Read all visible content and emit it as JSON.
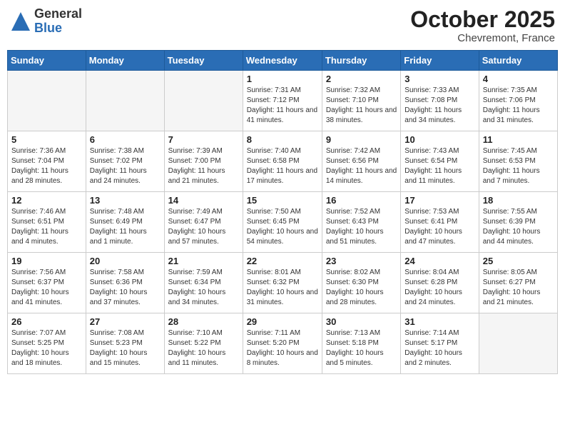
{
  "header": {
    "logo_general": "General",
    "logo_blue": "Blue",
    "month_title": "October 2025",
    "location": "Chevremont, France"
  },
  "weekdays": [
    "Sunday",
    "Monday",
    "Tuesday",
    "Wednesday",
    "Thursday",
    "Friday",
    "Saturday"
  ],
  "weeks": [
    [
      {
        "day": "",
        "info": ""
      },
      {
        "day": "",
        "info": ""
      },
      {
        "day": "",
        "info": ""
      },
      {
        "day": "1",
        "info": "Sunrise: 7:31 AM\nSunset: 7:12 PM\nDaylight: 11 hours and 41 minutes."
      },
      {
        "day": "2",
        "info": "Sunrise: 7:32 AM\nSunset: 7:10 PM\nDaylight: 11 hours and 38 minutes."
      },
      {
        "day": "3",
        "info": "Sunrise: 7:33 AM\nSunset: 7:08 PM\nDaylight: 11 hours and 34 minutes."
      },
      {
        "day": "4",
        "info": "Sunrise: 7:35 AM\nSunset: 7:06 PM\nDaylight: 11 hours and 31 minutes."
      }
    ],
    [
      {
        "day": "5",
        "info": "Sunrise: 7:36 AM\nSunset: 7:04 PM\nDaylight: 11 hours and 28 minutes."
      },
      {
        "day": "6",
        "info": "Sunrise: 7:38 AM\nSunset: 7:02 PM\nDaylight: 11 hours and 24 minutes."
      },
      {
        "day": "7",
        "info": "Sunrise: 7:39 AM\nSunset: 7:00 PM\nDaylight: 11 hours and 21 minutes."
      },
      {
        "day": "8",
        "info": "Sunrise: 7:40 AM\nSunset: 6:58 PM\nDaylight: 11 hours and 17 minutes."
      },
      {
        "day": "9",
        "info": "Sunrise: 7:42 AM\nSunset: 6:56 PM\nDaylight: 11 hours and 14 minutes."
      },
      {
        "day": "10",
        "info": "Sunrise: 7:43 AM\nSunset: 6:54 PM\nDaylight: 11 hours and 11 minutes."
      },
      {
        "day": "11",
        "info": "Sunrise: 7:45 AM\nSunset: 6:53 PM\nDaylight: 11 hours and 7 minutes."
      }
    ],
    [
      {
        "day": "12",
        "info": "Sunrise: 7:46 AM\nSunset: 6:51 PM\nDaylight: 11 hours and 4 minutes."
      },
      {
        "day": "13",
        "info": "Sunrise: 7:48 AM\nSunset: 6:49 PM\nDaylight: 11 hours and 1 minute."
      },
      {
        "day": "14",
        "info": "Sunrise: 7:49 AM\nSunset: 6:47 PM\nDaylight: 10 hours and 57 minutes."
      },
      {
        "day": "15",
        "info": "Sunrise: 7:50 AM\nSunset: 6:45 PM\nDaylight: 10 hours and 54 minutes."
      },
      {
        "day": "16",
        "info": "Sunrise: 7:52 AM\nSunset: 6:43 PM\nDaylight: 10 hours and 51 minutes."
      },
      {
        "day": "17",
        "info": "Sunrise: 7:53 AM\nSunset: 6:41 PM\nDaylight: 10 hours and 47 minutes."
      },
      {
        "day": "18",
        "info": "Sunrise: 7:55 AM\nSunset: 6:39 PM\nDaylight: 10 hours and 44 minutes."
      }
    ],
    [
      {
        "day": "19",
        "info": "Sunrise: 7:56 AM\nSunset: 6:37 PM\nDaylight: 10 hours and 41 minutes."
      },
      {
        "day": "20",
        "info": "Sunrise: 7:58 AM\nSunset: 6:36 PM\nDaylight: 10 hours and 37 minutes."
      },
      {
        "day": "21",
        "info": "Sunrise: 7:59 AM\nSunset: 6:34 PM\nDaylight: 10 hours and 34 minutes."
      },
      {
        "day": "22",
        "info": "Sunrise: 8:01 AM\nSunset: 6:32 PM\nDaylight: 10 hours and 31 minutes."
      },
      {
        "day": "23",
        "info": "Sunrise: 8:02 AM\nSunset: 6:30 PM\nDaylight: 10 hours and 28 minutes."
      },
      {
        "day": "24",
        "info": "Sunrise: 8:04 AM\nSunset: 6:28 PM\nDaylight: 10 hours and 24 minutes."
      },
      {
        "day": "25",
        "info": "Sunrise: 8:05 AM\nSunset: 6:27 PM\nDaylight: 10 hours and 21 minutes."
      }
    ],
    [
      {
        "day": "26",
        "info": "Sunrise: 7:07 AM\nSunset: 5:25 PM\nDaylight: 10 hours and 18 minutes."
      },
      {
        "day": "27",
        "info": "Sunrise: 7:08 AM\nSunset: 5:23 PM\nDaylight: 10 hours and 15 minutes."
      },
      {
        "day": "28",
        "info": "Sunrise: 7:10 AM\nSunset: 5:22 PM\nDaylight: 10 hours and 11 minutes."
      },
      {
        "day": "29",
        "info": "Sunrise: 7:11 AM\nSunset: 5:20 PM\nDaylight: 10 hours and 8 minutes."
      },
      {
        "day": "30",
        "info": "Sunrise: 7:13 AM\nSunset: 5:18 PM\nDaylight: 10 hours and 5 minutes."
      },
      {
        "day": "31",
        "info": "Sunrise: 7:14 AM\nSunset: 5:17 PM\nDaylight: 10 hours and 2 minutes."
      },
      {
        "day": "",
        "info": ""
      }
    ]
  ]
}
